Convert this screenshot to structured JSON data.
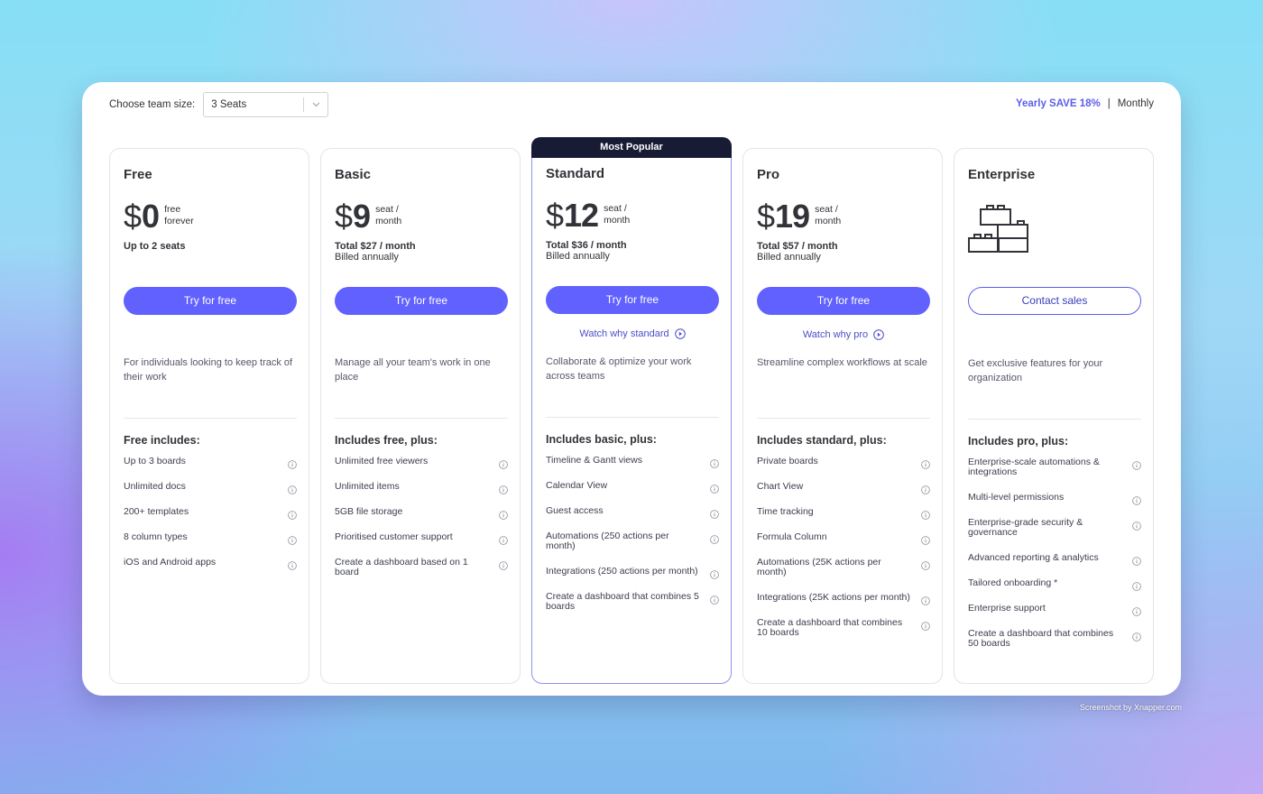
{
  "header": {
    "team_size_label": "Choose team size:",
    "team_size_value": "3 Seats",
    "billing_yearly": "Yearly SAVE 18%",
    "billing_separator": "|",
    "billing_monthly": "Monthly"
  },
  "colors": {
    "accent": "#6161ff",
    "popular_banner": "#181b34",
    "link": "#4a4ec9"
  },
  "popular_badge": "Most Popular",
  "plans": [
    {
      "name": "Free",
      "price_symbol": "$",
      "price": "0",
      "unit_line1": "free",
      "unit_line2": "forever",
      "total": "Up to 2 seats",
      "billed": "",
      "cta": "Try for free",
      "watch": "",
      "description": "For individuals looking to keep track of their work",
      "includes_title": "Free includes:",
      "features": [
        "Up to 3 boards",
        "Unlimited docs",
        "200+ templates",
        "8 column types",
        "iOS and Android apps"
      ]
    },
    {
      "name": "Basic",
      "price_symbol": "$",
      "price": "9",
      "unit_line1": "seat /",
      "unit_line2": "month",
      "total": "Total $27 / month",
      "billed": "Billed annually",
      "cta": "Try for free",
      "watch": "",
      "description": "Manage all your team's work in one place",
      "includes_title": "Includes free, plus:",
      "features": [
        "Unlimited free viewers",
        "Unlimited items",
        "5GB file storage",
        "Prioritised customer support",
        "Create a dashboard based on 1 board"
      ]
    },
    {
      "name": "Standard",
      "price_symbol": "$",
      "price": "12",
      "unit_line1": "seat /",
      "unit_line2": "month",
      "total": "Total $36 / month",
      "billed": "Billed annually",
      "cta": "Try for free",
      "watch": "Watch why standard",
      "description": "Collaborate & optimize your work across teams",
      "includes_title": "Includes basic, plus:",
      "features": [
        "Timeline & Gantt views",
        "Calendar View",
        "Guest access",
        "Automations (250 actions per month)",
        "Integrations (250 actions per month)",
        "Create a dashboard that combines 5 boards"
      ]
    },
    {
      "name": "Pro",
      "price_symbol": "$",
      "price": "19",
      "unit_line1": "seat /",
      "unit_line2": "month",
      "total": "Total $57 / month",
      "billed": "Billed annually",
      "cta": "Try for free",
      "watch": "Watch why pro",
      "description": "Streamline complex workflows at scale",
      "includes_title": "Includes standard, plus:",
      "features": [
        "Private boards",
        "Chart View",
        "Time tracking",
        "Formula Column",
        "Automations (25K actions per month)",
        "Integrations (25K actions per month)",
        "Create a dashboard that combines 10 boards"
      ]
    },
    {
      "name": "Enterprise",
      "cta": "Contact sales",
      "description": "Get exclusive features for your organization",
      "includes_title": "Includes pro, plus:",
      "features": [
        "Enterprise-scale automations & integrations",
        "Multi-level permissions",
        "Enterprise-grade security & governance",
        "Advanced reporting & analytics",
        "Tailored onboarding *",
        "Enterprise support",
        "Create a dashboard that combines 50 boards"
      ]
    }
  ],
  "watermark": "Screenshot by Xnapper.com"
}
